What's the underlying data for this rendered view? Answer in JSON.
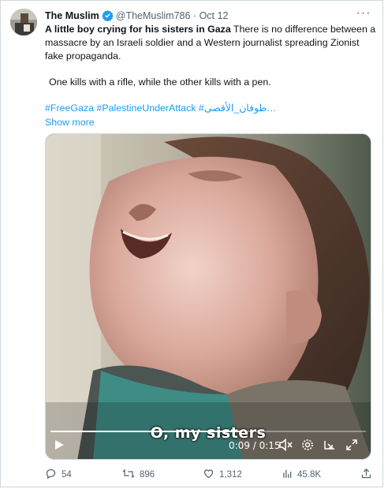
{
  "tweet": {
    "display_name": "The Muslim",
    "handle": "@TheMuslim786",
    "separator": "·",
    "date": "Oct 12",
    "more_label": "···",
    "lead_bold": "A little boy crying for his sisters in Gaza",
    "lead_rest": " There is no difference between a massacre by an Israeli soldier and a Western journalist spreading Zionist fake propaganda.",
    "para2": "One kills with a rifle, while the other kills with a pen.",
    "hashtags": "#FreeGaza #PalestineUnderAttack #طوفان_الأقصى…",
    "show_more": "Show more"
  },
  "video": {
    "caption": "O, my sisters",
    "time": "0:09 / 0:15",
    "progress": 0.6
  },
  "actions": {
    "replies": "54",
    "retweets": "896",
    "likes": "1,312",
    "views": "45.8K"
  },
  "colors": {
    "link": "#1d9bf0",
    "verified": "#1d9bf0",
    "muted": "#536471"
  },
  "icons": [
    "verified-badge-icon",
    "more-icon",
    "play-icon",
    "volume-muted-icon",
    "settings-icon",
    "pip-icon",
    "fullscreen-icon",
    "reply-icon",
    "retweet-icon",
    "like-icon",
    "views-icon",
    "share-icon"
  ]
}
